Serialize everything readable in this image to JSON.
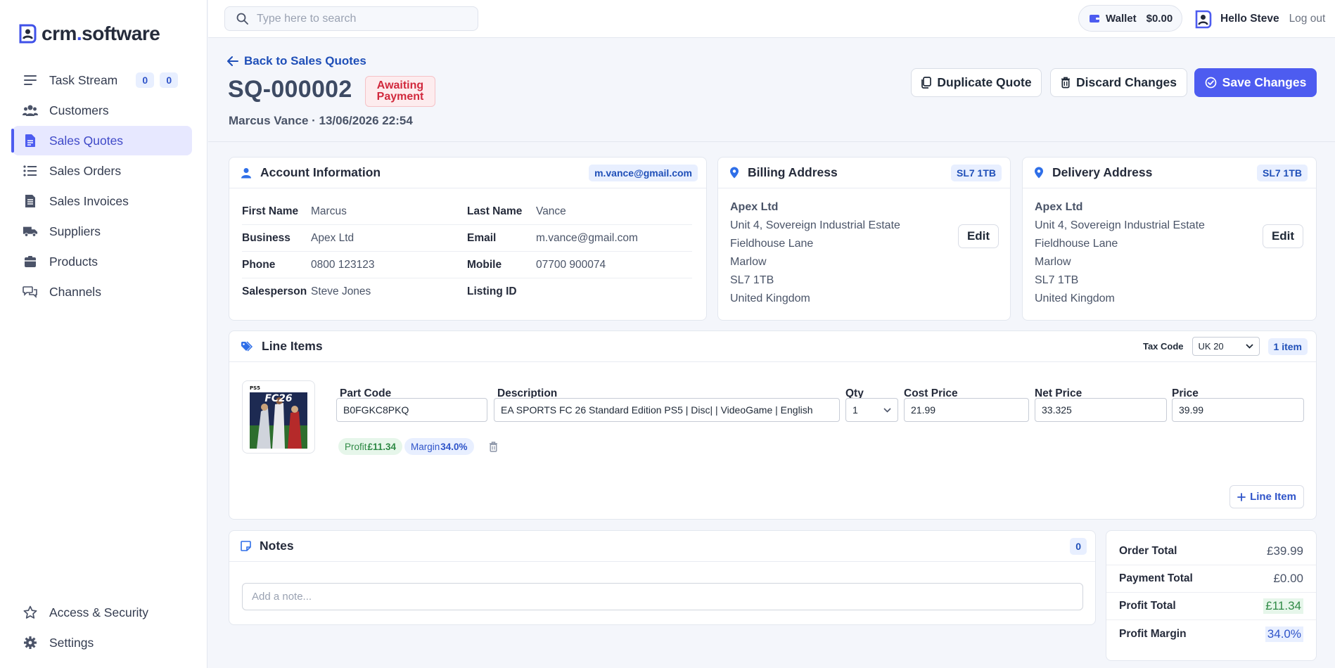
{
  "brand": {
    "name_a": "crm",
    "name_dot": ".",
    "name_b": "software"
  },
  "sidebar": {
    "items": [
      {
        "label": "Task Stream",
        "icon": "menu-icon",
        "badge1": "0",
        "badge2": "0"
      },
      {
        "label": "Customers",
        "icon": "users-icon"
      },
      {
        "label": "Sales Quotes",
        "icon": "document-icon",
        "active": true
      },
      {
        "label": "Sales Orders",
        "icon": "list-icon"
      },
      {
        "label": "Sales Invoices",
        "icon": "invoice-icon"
      },
      {
        "label": "Suppliers",
        "icon": "truck-icon"
      },
      {
        "label": "Products",
        "icon": "box-icon"
      },
      {
        "label": "Channels",
        "icon": "chat-icon"
      }
    ],
    "bottom": [
      {
        "label": "Access & Security",
        "icon": "star-icon"
      },
      {
        "label": "Settings",
        "icon": "gear-icon"
      }
    ]
  },
  "topbar": {
    "search_placeholder": "Type here to search",
    "wallet_label": "Wallet",
    "wallet_amount": "$0.00",
    "hello": "Hello Steve",
    "logout": "Log out"
  },
  "header": {
    "back": "Back to Sales Quotes",
    "quote_id": "SQ-000002",
    "status_line1": "Awaiting",
    "status_line2": "Payment",
    "subtitle": "Marcus Vance · 13/06/2026 22:54",
    "duplicate": "Duplicate Quote",
    "discard": "Discard Changes",
    "save": "Save Changes"
  },
  "account": {
    "title": "Account Information",
    "email_badge": "m.vance@gmail.com",
    "rows": [
      {
        "l1": "First Name",
        "v1": "Marcus",
        "l2": "Last Name",
        "v2": "Vance"
      },
      {
        "l1": "Business",
        "v1": "Apex Ltd",
        "l2": "Email",
        "v2": "m.vance@gmail.com"
      },
      {
        "l1": "Phone",
        "v1": "0800 123123",
        "l2": "Mobile",
        "v2": "07700 900074"
      },
      {
        "l1": "Salesperson",
        "v1": "Steve Jones",
        "l2": "Listing ID",
        "v2": ""
      }
    ]
  },
  "billing": {
    "title": "Billing Address",
    "postcode_badge": "SL7 1TB",
    "company": "Apex Ltd",
    "line1": "Unit 4, Sovereign Industrial Estate",
    "line2": "Fieldhouse Lane",
    "city": "Marlow",
    "postcode": "SL7 1TB",
    "country": "United Kingdom",
    "edit": "Edit"
  },
  "delivery": {
    "title": "Delivery Address",
    "postcode_badge": "SL7 1TB",
    "company": "Apex Ltd",
    "line1": "Unit 4, Sovereign Industrial Estate",
    "line2": "Fieldhouse Lane",
    "city": "Marlow",
    "postcode": "SL7 1TB",
    "country": "United Kingdom",
    "edit": "Edit"
  },
  "line_items": {
    "title": "Line Items",
    "tax_label": "Tax Code",
    "tax_value": "UK 20",
    "count_badge": "1 item",
    "headers": {
      "part": "Part Code",
      "desc": "Description",
      "qty": "Qty",
      "cost": "Cost Price",
      "net": "Net Price",
      "price": "Price"
    },
    "item": {
      "thumb_label": "PS5",
      "thumb_title": "FC26",
      "part": "B0FGKC8PKQ",
      "desc": "EA SPORTS FC 26 Standard Edition PS5 | Disc| | VideoGame | English",
      "qty": "1",
      "cost": "21.99",
      "net": "33.325",
      "price": "39.99",
      "profit_label": "Profit",
      "profit_value": "£11.34",
      "margin_label": "Margin",
      "margin_value": "34.0%"
    },
    "add_button": "Line Item"
  },
  "notes": {
    "title": "Notes",
    "count": "0",
    "placeholder": "Add a note..."
  },
  "totals": {
    "rows": [
      {
        "label": "Order Total",
        "value": "£39.99"
      },
      {
        "label": "Payment Total",
        "value": "£0.00"
      },
      {
        "label": "Profit Total",
        "value": "£11.34"
      },
      {
        "label": "Profit Margin",
        "value": "34.0%"
      }
    ]
  },
  "colors": {
    "accent": "#4d5cf0",
    "link": "#1f4fb8",
    "danger": "#d1293d",
    "success": "#2f8a46"
  }
}
